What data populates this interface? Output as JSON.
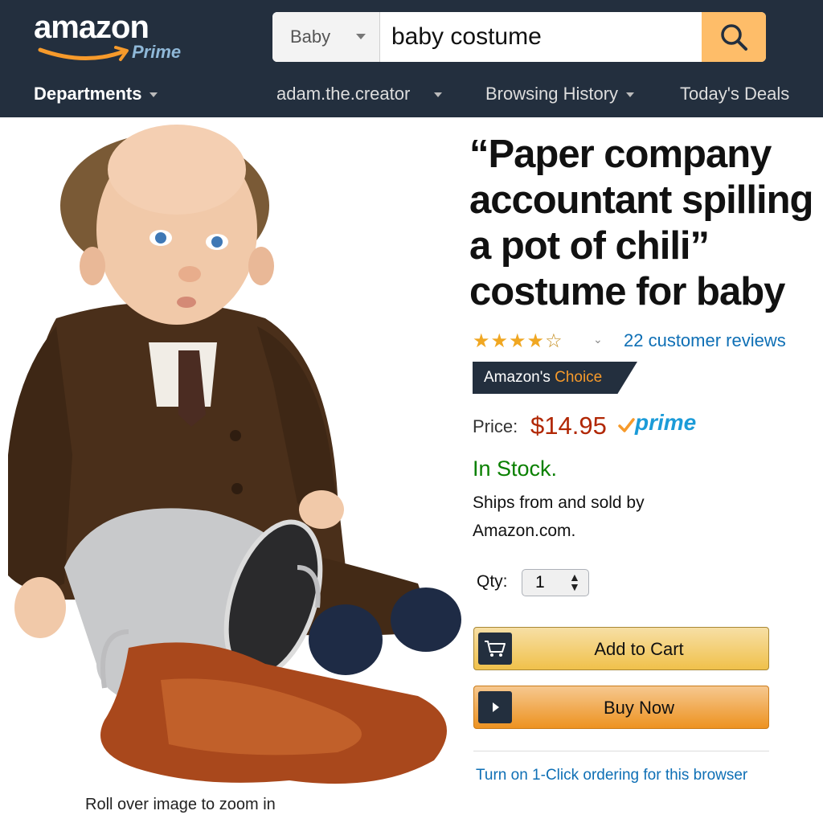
{
  "logo": {
    "word": "amazon",
    "sub": "Prime"
  },
  "search": {
    "category": "Baby",
    "query": "baby costume"
  },
  "nav": {
    "departments": "Departments",
    "account": "adam.the.creator",
    "history": "Browsing History",
    "deals": "Today's Deals"
  },
  "product": {
    "title": "“Paper company accountant spilling a pot of chili” costume for baby",
    "rating_stars": 4,
    "reviews": "22 customer reviews",
    "badge_prefix": "Amazon's",
    "badge_choice": "Choice",
    "price_label": "Price:",
    "price": "$14.95",
    "prime_label": "prime",
    "stock": "In Stock.",
    "ships": "Ships from and sold by Amazon.com.",
    "qty_label": "Qty:",
    "qty_value": "1",
    "add_to_cart": "Add to Cart",
    "buy_now": "Buy Now",
    "one_click": "Turn on 1-Click ordering for this browser",
    "zoom_hint": "Roll over image to zoom in"
  },
  "colors": {
    "header_bg": "#232f3e",
    "price": "#b12704",
    "stock": "#0a8000",
    "link": "#0e6fb5",
    "prime": "#1b9bd8",
    "search_button": "#febd69"
  },
  "icons": [
    "search-icon",
    "cart-icon",
    "play-icon",
    "check-icon",
    "star-icon"
  ]
}
